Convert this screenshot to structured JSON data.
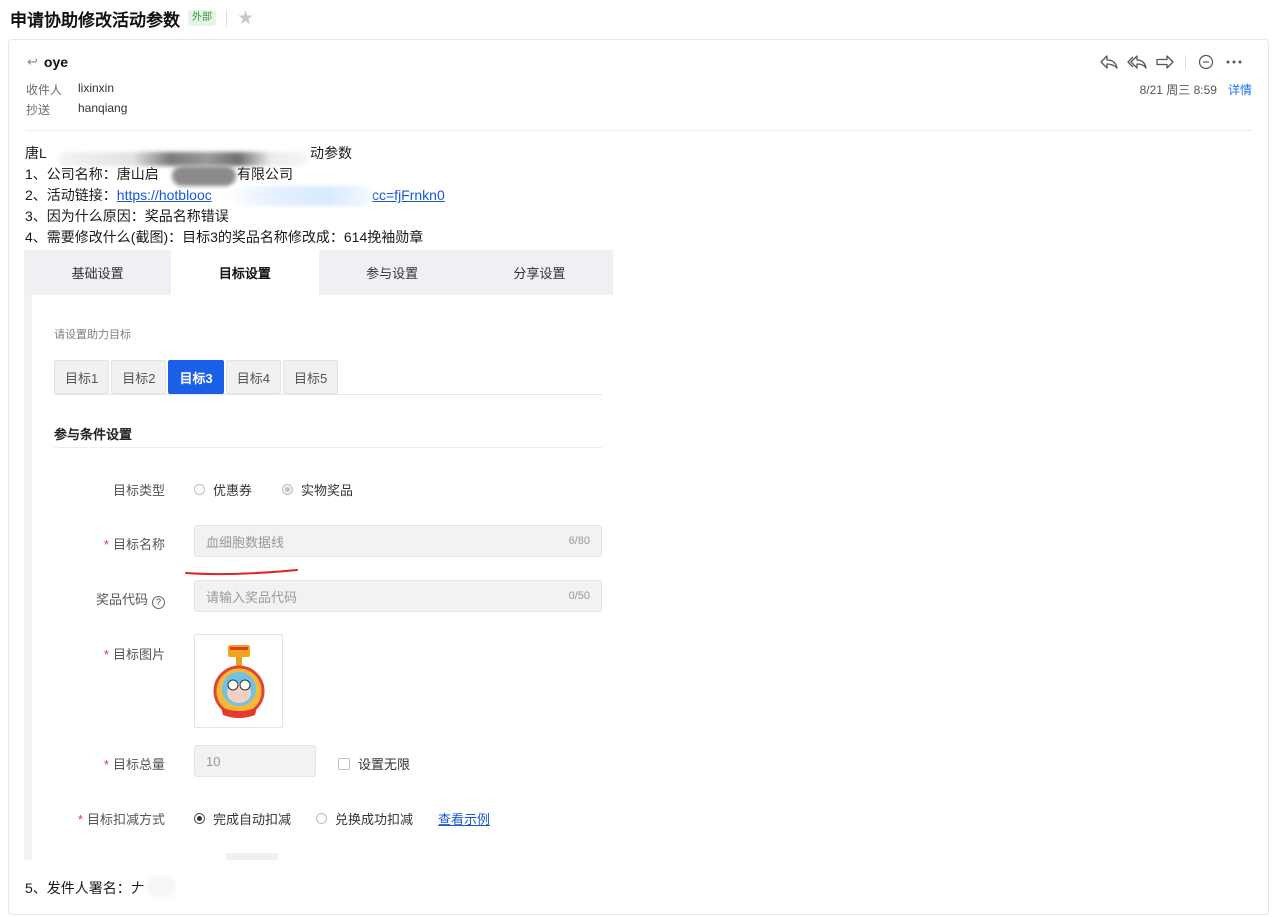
{
  "header": {
    "subject": "申请协助修改活动参数",
    "badge": "外部",
    "star_icon": "star-icon"
  },
  "mail": {
    "sender": "oye",
    "to_label": "收件人",
    "to_value": "lixinxin",
    "cc_label": "抄送",
    "cc_value": "hanqiang",
    "date": "8/21 周三 8:59",
    "detail_link": "详情",
    "action_icons": [
      "reply-icon",
      "reply-all-icon",
      "forward-icon",
      "comment-icon",
      "more-icon"
    ]
  },
  "body": {
    "line0_a": "唐L",
    "line0_b": "动参数",
    "line1_a": "1、公司名称：唐山启",
    "line1_b": "有限公司",
    "line2_label": "2、活动链接：",
    "line2_link_a": "https://hotblooc",
    "line2_link_b": "cc=fjFrnkn0",
    "line3": "3、因为什么原因：奖品名称错误",
    "line4": "4、需要修改什么(截图)：目标3的奖品名称修改成：614挽袖勋章",
    "line5": "5、发件人署名：𠂇"
  },
  "screenshot": {
    "tabs": [
      "基础设置",
      "目标设置",
      "参与设置",
      "分享设置"
    ],
    "hint": "请设置助力目标",
    "goals": [
      "目标1",
      "目标2",
      "目标3",
      "目标4",
      "目标5"
    ],
    "section_title": "参与条件设置",
    "type_label": "目标类型",
    "type_opt1": "优惠券",
    "type_opt2": "实物奖品",
    "name_label": "目标名称",
    "name_value": "血细胞数据线",
    "name_count": "6/80",
    "code_label": "奖品代码",
    "code_placeholder": "请输入奖品代码",
    "code_count": "0/50",
    "image_label": "目标图片",
    "total_label": "目标总量",
    "total_value": "10",
    "unlimited_label": "设置无限",
    "deduct_label": "目标扣减方式",
    "deduct_opt1": "完成自动扣减",
    "deduct_opt2": "兑换成功扣减",
    "example_link": "查看示例",
    "accent_color": "#1a5fe8"
  }
}
